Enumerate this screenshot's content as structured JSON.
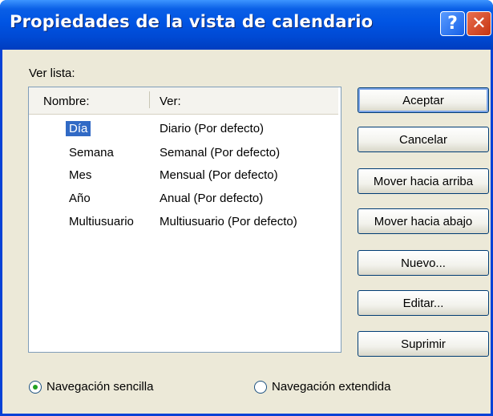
{
  "window": {
    "title": "Propiedades de la vista de calendario",
    "help_glyph": "?",
    "close_glyph": "✕"
  },
  "list": {
    "label": "Ver lista:",
    "columns": [
      "Nombre:",
      "Ver:"
    ],
    "rows": [
      {
        "name": "Día",
        "view": "Diario (Por defecto)",
        "selected": true
      },
      {
        "name": "Semana",
        "view": "Semanal (Por defecto)",
        "selected": false
      },
      {
        "name": "Mes",
        "view": "Mensual (Por defecto)",
        "selected": false
      },
      {
        "name": "Año",
        "view": "Anual (Por defecto)",
        "selected": false
      },
      {
        "name": "Multiusuario",
        "view": "Multiusuario (Por defecto)",
        "selected": false
      }
    ]
  },
  "buttons": {
    "accept": "Aceptar",
    "cancel": "Cancelar",
    "move_up": "Mover hacia arriba",
    "move_down": "Mover hacia abajo",
    "new": "Nuevo...",
    "edit": "Editar...",
    "delete": "Suprimir"
  },
  "navigation": {
    "simple": "Navegación sencilla",
    "extended": "Navegación extendida",
    "selected": "simple"
  }
}
